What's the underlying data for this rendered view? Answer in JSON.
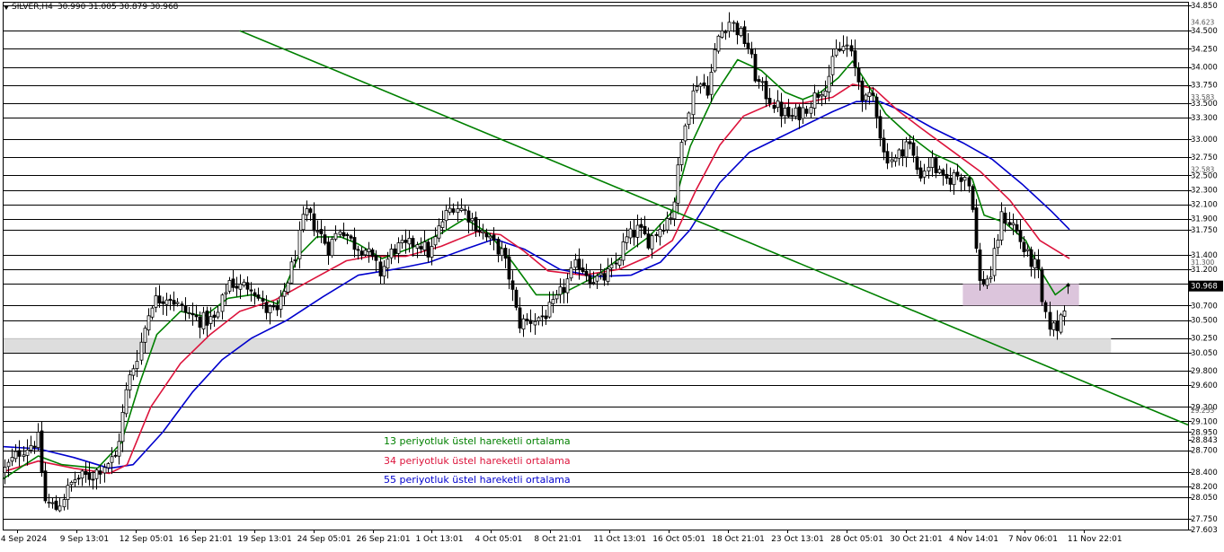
{
  "header": {
    "symbol": "SILVER,H4",
    "ohlc": "30.990 31.005 30.879 30.968"
  },
  "legend": {
    "ema13": "13 periyotluk üstel hareketli ortalama",
    "ema34": "34 periyotluk üstel hareketli ortalama",
    "ema55": "55 periyotluk üstel hareketli ortalama"
  },
  "colors": {
    "ema13": "#008000",
    "ema34": "#dc143c",
    "ema55": "#0000cd",
    "candles": "#000000",
    "trendline": "#008000",
    "support_zone": "#d9d9d9",
    "resistance_zone": "#d8bfd8",
    "price_tag_bg": "#000000",
    "price_tag_text": "#ffffff"
  },
  "chart_data": {
    "type": "candlestick",
    "symbol": "SILVER",
    "timeframe": "H4",
    "ylim": [
      27.603,
      34.9
    ],
    "y_ticks": [
      "34.850",
      "34.500",
      "34.250",
      "34.000",
      "33.750",
      "33.500",
      "33.300",
      "33.000",
      "32.750",
      "32.500",
      "32.300",
      "32.100",
      "31.900",
      "31.750",
      "31.400",
      "31.200",
      "31.000",
      "30.700",
      "30.500",
      "30.250",
      "30.050",
      "29.800",
      "29.600",
      "29.300",
      "29.100",
      "28.950",
      "28.843",
      "28.700",
      "28.400",
      "28.200",
      "28.050",
      "27.750",
      "27.603"
    ],
    "dense_ticks": [
      "34.623",
      "33.583",
      "32.583",
      "31.300",
      "30.968",
      "29.253"
    ],
    "horizontal_levels": [
      34.85,
      34.5,
      34.25,
      34.0,
      33.75,
      33.5,
      33.3,
      33.0,
      32.75,
      32.5,
      32.3,
      32.1,
      31.9,
      31.75,
      31.4,
      31.2,
      31.0,
      30.7,
      30.5,
      30.25,
      30.05,
      29.8,
      29.6,
      29.3,
      29.1,
      28.95,
      28.7,
      28.4,
      28.2,
      28.05,
      27.75
    ],
    "x_labels": [
      "4 Sep 2024",
      "9 Sep 13:01",
      "12 Sep 05:01",
      "16 Sep 21:01",
      "19 Sep 13:01",
      "24 Sep 05:01",
      "26 Sep 21:01",
      "1 Oct 13:01",
      "4 Oct 05:01",
      "8 Oct 21:01",
      "11 Oct 13:01",
      "16 Oct 05:01",
      "18 Oct 21:01",
      "23 Oct 13:01",
      "28 Oct 05:01",
      "30 Oct 21:01",
      "4 Nov 14:01",
      "7 Nov 06:01",
      "11 Nov 22:01"
    ],
    "support_zone": {
      "low": 30.05,
      "high": 30.25
    },
    "resistance_zone": {
      "low": 30.7,
      "high": 31.0
    },
    "trendline": {
      "from": [
        0.2,
        34.5
      ],
      "to": [
        1.0,
        29.05
      ]
    },
    "close_path": [
      [
        0.0,
        28.4
      ],
      [
        0.015,
        28.7
      ],
      [
        0.03,
        28.85
      ],
      [
        0.035,
        28.0
      ],
      [
        0.045,
        27.9
      ],
      [
        0.06,
        28.3
      ],
      [
        0.075,
        28.35
      ],
      [
        0.085,
        28.5
      ],
      [
        0.095,
        28.6
      ],
      [
        0.105,
        29.6
      ],
      [
        0.115,
        30.1
      ],
      [
        0.125,
        30.75
      ],
      [
        0.14,
        30.85
      ],
      [
        0.15,
        30.65
      ],
      [
        0.165,
        30.5
      ],
      [
        0.18,
        30.5
      ],
      [
        0.19,
        31.05
      ],
      [
        0.2,
        30.95
      ],
      [
        0.21,
        31.0
      ],
      [
        0.22,
        30.65
      ],
      [
        0.232,
        30.6
      ],
      [
        0.245,
        31.3
      ],
      [
        0.255,
        32.0
      ],
      [
        0.265,
        31.75
      ],
      [
        0.275,
        31.5
      ],
      [
        0.285,
        31.8
      ],
      [
        0.295,
        31.55
      ],
      [
        0.305,
        31.5
      ],
      [
        0.318,
        31.15
      ],
      [
        0.33,
        31.5
      ],
      [
        0.34,
        31.5
      ],
      [
        0.35,
        31.6
      ],
      [
        0.36,
        31.4
      ],
      [
        0.37,
        31.85
      ],
      [
        0.38,
        32.1
      ],
      [
        0.39,
        32.0
      ],
      [
        0.4,
        31.8
      ],
      [
        0.41,
        31.6
      ],
      [
        0.42,
        31.45
      ],
      [
        0.427,
        31.1
      ],
      [
        0.435,
        30.45
      ],
      [
        0.445,
        30.5
      ],
      [
        0.455,
        30.55
      ],
      [
        0.465,
        30.7
      ],
      [
        0.475,
        31.0
      ],
      [
        0.485,
        31.3
      ],
      [
        0.495,
        31.1
      ],
      [
        0.505,
        31.05
      ],
      [
        0.515,
        31.2
      ],
      [
        0.525,
        31.6
      ],
      [
        0.535,
        31.75
      ],
      [
        0.545,
        31.6
      ],
      [
        0.555,
        31.8
      ],
      [
        0.565,
        32.0
      ],
      [
        0.575,
        33.25
      ],
      [
        0.585,
        33.8
      ],
      [
        0.595,
        33.7
      ],
      [
        0.603,
        34.4
      ],
      [
        0.612,
        34.65
      ],
      [
        0.62,
        34.5
      ],
      [
        0.628,
        34.3
      ],
      [
        0.636,
        33.8
      ],
      [
        0.645,
        33.6
      ],
      [
        0.655,
        33.4
      ],
      [
        0.665,
        33.3
      ],
      [
        0.675,
        33.4
      ],
      [
        0.685,
        33.6
      ],
      [
        0.695,
        33.8
      ],
      [
        0.703,
        34.2
      ],
      [
        0.712,
        34.3
      ],
      [
        0.72,
        33.9
      ],
      [
        0.727,
        33.5
      ],
      [
        0.735,
        33.6
      ],
      [
        0.743,
        32.8
      ],
      [
        0.753,
        32.7
      ],
      [
        0.763,
        33.0
      ],
      [
        0.773,
        32.5
      ],
      [
        0.783,
        32.7
      ],
      [
        0.793,
        32.4
      ],
      [
        0.803,
        32.5
      ],
      [
        0.813,
        32.5
      ],
      [
        0.818,
        32.1
      ],
      [
        0.823,
        31.0
      ],
      [
        0.833,
        31.1
      ],
      [
        0.843,
        31.95
      ],
      [
        0.853,
        31.8
      ],
      [
        0.863,
        31.4
      ],
      [
        0.873,
        31.2
      ],
      [
        0.878,
        30.55
      ],
      [
        0.888,
        30.35
      ],
      [
        0.895,
        30.7
      ],
      [
        0.9,
        30.97
      ]
    ],
    "ema13_path": [
      [
        0.0,
        28.3
      ],
      [
        0.03,
        28.62
      ],
      [
        0.05,
        28.5
      ],
      [
        0.08,
        28.45
      ],
      [
        0.1,
        28.8
      ],
      [
        0.115,
        29.6
      ],
      [
        0.13,
        30.3
      ],
      [
        0.15,
        30.62
      ],
      [
        0.17,
        30.55
      ],
      [
        0.19,
        30.8
      ],
      [
        0.21,
        30.85
      ],
      [
        0.232,
        30.72
      ],
      [
        0.25,
        31.4
      ],
      [
        0.265,
        31.65
      ],
      [
        0.285,
        31.65
      ],
      [
        0.3,
        31.55
      ],
      [
        0.32,
        31.35
      ],
      [
        0.345,
        31.5
      ],
      [
        0.37,
        31.7
      ],
      [
        0.39,
        31.9
      ],
      [
        0.41,
        31.7
      ],
      [
        0.43,
        31.3
      ],
      [
        0.45,
        30.85
      ],
      [
        0.47,
        30.85
      ],
      [
        0.5,
        31.1
      ],
      [
        0.52,
        31.35
      ],
      [
        0.545,
        31.65
      ],
      [
        0.565,
        32.0
      ],
      [
        0.58,
        32.9
      ],
      [
        0.6,
        33.6
      ],
      [
        0.62,
        34.1
      ],
      [
        0.64,
        33.95
      ],
      [
        0.66,
        33.65
      ],
      [
        0.675,
        33.55
      ],
      [
        0.69,
        33.65
      ],
      [
        0.705,
        33.85
      ],
      [
        0.717,
        34.08
      ],
      [
        0.73,
        33.75
      ],
      [
        0.745,
        33.35
      ],
      [
        0.765,
        33.05
      ],
      [
        0.785,
        32.8
      ],
      [
        0.805,
        32.65
      ],
      [
        0.818,
        32.45
      ],
      [
        0.828,
        31.95
      ],
      [
        0.845,
        31.85
      ],
      [
        0.863,
        31.6
      ],
      [
        0.875,
        31.2
      ],
      [
        0.888,
        30.85
      ],
      [
        0.9,
        31.0
      ]
    ],
    "ema34_path": [
      [
        0.0,
        28.4
      ],
      [
        0.03,
        28.55
      ],
      [
        0.06,
        28.45
      ],
      [
        0.09,
        28.38
      ],
      [
        0.105,
        28.5
      ],
      [
        0.125,
        29.3
      ],
      [
        0.15,
        29.9
      ],
      [
        0.175,
        30.3
      ],
      [
        0.2,
        30.62
      ],
      [
        0.23,
        30.78
      ],
      [
        0.26,
        31.05
      ],
      [
        0.29,
        31.32
      ],
      [
        0.31,
        31.38
      ],
      [
        0.34,
        31.38
      ],
      [
        0.37,
        31.52
      ],
      [
        0.4,
        31.72
      ],
      [
        0.42,
        31.68
      ],
      [
        0.44,
        31.45
      ],
      [
        0.46,
        31.18
      ],
      [
        0.49,
        31.12
      ],
      [
        0.52,
        31.2
      ],
      [
        0.545,
        31.38
      ],
      [
        0.565,
        31.6
      ],
      [
        0.585,
        32.3
      ],
      [
        0.605,
        32.92
      ],
      [
        0.625,
        33.32
      ],
      [
        0.65,
        33.5
      ],
      [
        0.675,
        33.5
      ],
      [
        0.7,
        33.58
      ],
      [
        0.717,
        33.76
      ],
      [
        0.735,
        33.7
      ],
      [
        0.755,
        33.4
      ],
      [
        0.775,
        33.15
      ],
      [
        0.8,
        32.85
      ],
      [
        0.825,
        32.55
      ],
      [
        0.85,
        32.15
      ],
      [
        0.875,
        31.6
      ],
      [
        0.9,
        31.35
      ]
    ],
    "ema55_path": [
      [
        0.0,
        28.75
      ],
      [
        0.03,
        28.72
      ],
      [
        0.06,
        28.6
      ],
      [
        0.09,
        28.45
      ],
      [
        0.11,
        28.5
      ],
      [
        0.135,
        28.95
      ],
      [
        0.16,
        29.5
      ],
      [
        0.185,
        29.95
      ],
      [
        0.21,
        30.25
      ],
      [
        0.24,
        30.5
      ],
      [
        0.27,
        30.82
      ],
      [
        0.3,
        31.12
      ],
      [
        0.33,
        31.2
      ],
      [
        0.36,
        31.3
      ],
      [
        0.39,
        31.48
      ],
      [
        0.415,
        31.62
      ],
      [
        0.44,
        31.48
      ],
      [
        0.47,
        31.2
      ],
      [
        0.5,
        31.1
      ],
      [
        0.53,
        31.12
      ],
      [
        0.555,
        31.3
      ],
      [
        0.58,
        31.75
      ],
      [
        0.605,
        32.4
      ],
      [
        0.63,
        32.82
      ],
      [
        0.655,
        33.02
      ],
      [
        0.68,
        33.22
      ],
      [
        0.7,
        33.38
      ],
      [
        0.72,
        33.52
      ],
      [
        0.74,
        33.52
      ],
      [
        0.76,
        33.38
      ],
      [
        0.785,
        33.15
      ],
      [
        0.81,
        32.95
      ],
      [
        0.835,
        32.72
      ],
      [
        0.86,
        32.38
      ],
      [
        0.885,
        32.0
      ],
      [
        0.9,
        31.75
      ]
    ]
  }
}
